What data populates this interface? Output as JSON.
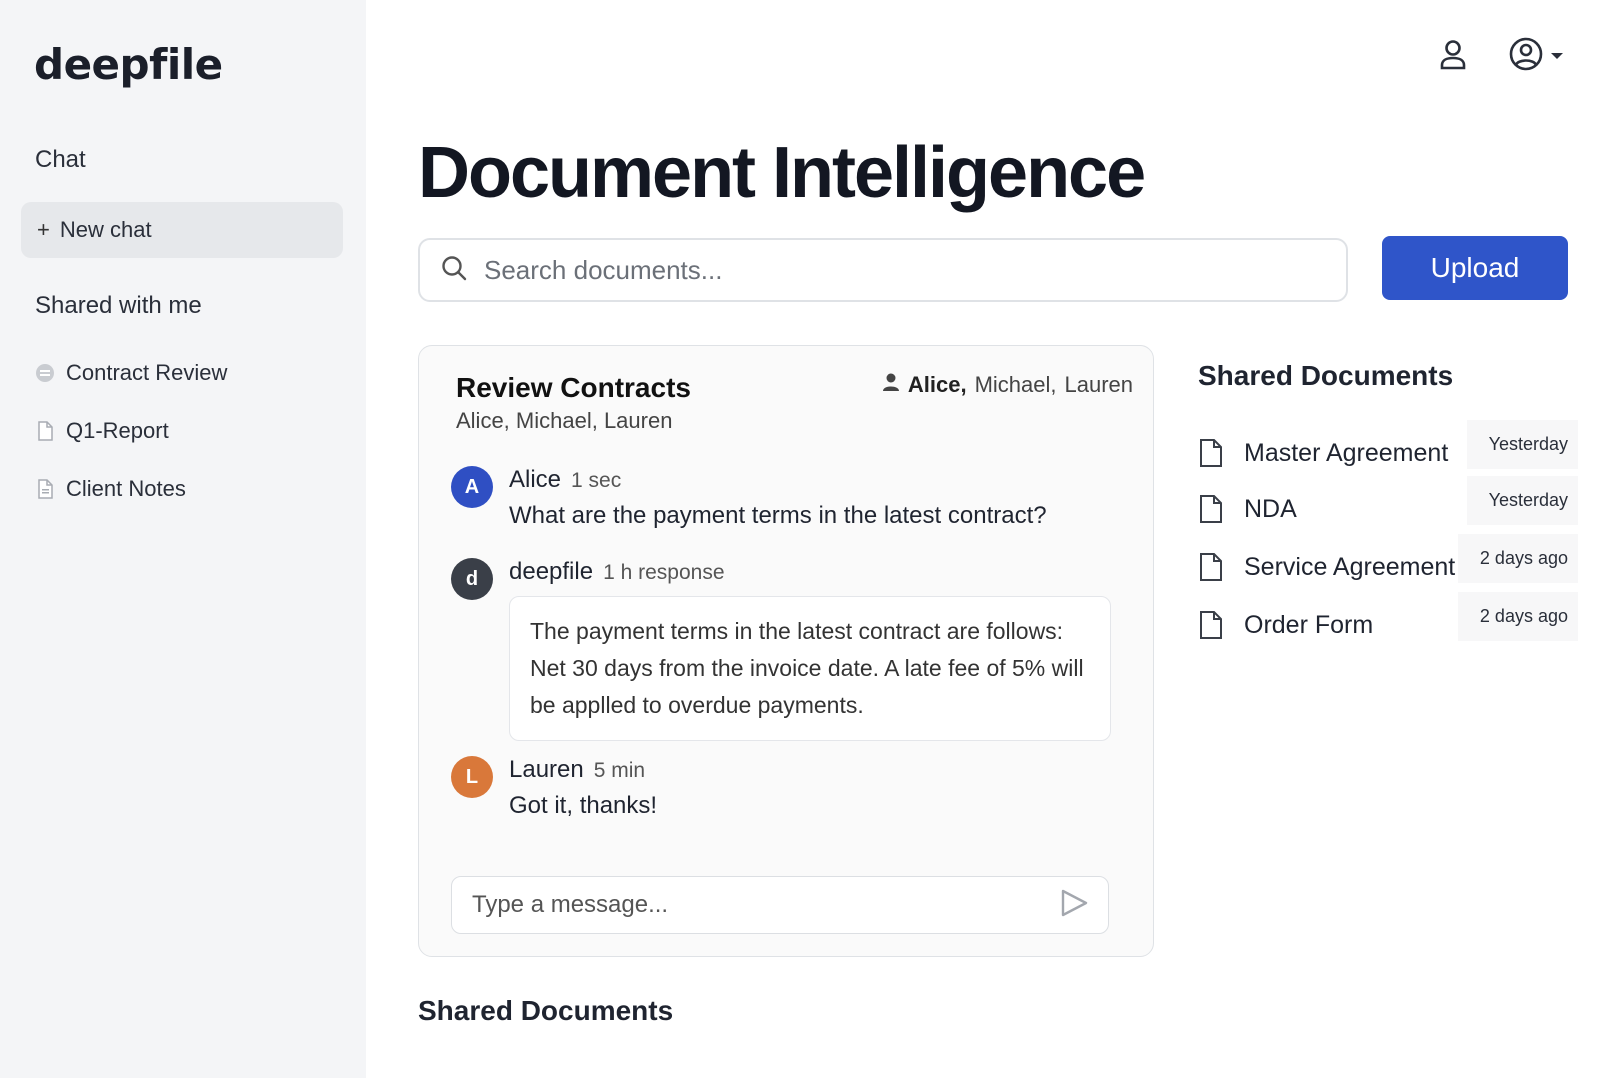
{
  "sidebar": {
    "logo": "deepfile",
    "chat_heading": "Chat",
    "new_chat_plus": "+",
    "new_chat_label": "New chat",
    "shared_heading": "Shared with me",
    "items": [
      {
        "label": "Contract Review",
        "icon": "chat-bubble-icon"
      },
      {
        "label": "Q1-Report",
        "icon": "file-icon"
      },
      {
        "label": "Client Notes",
        "icon": "note-file-icon"
      }
    ]
  },
  "header": {
    "icons": [
      "user-icon",
      "account-circle-icon",
      "caret-down-icon"
    ]
  },
  "main": {
    "title": "Document Intelligence",
    "search": {
      "placeholder": "Search documents..."
    },
    "upload_label": "Upload",
    "bottom_heading": "Shared Documents"
  },
  "chat": {
    "title": "Review Contracts",
    "subtitle": "Alice, Michael, Lauren",
    "participants": {
      "first": "Alice,",
      "second": "Michael,",
      "third": "Lauren"
    },
    "messages": [
      {
        "initial": "A",
        "author": "Alice",
        "time": "1 sec",
        "text": "What are the payment terms in the latest contract?",
        "color": "#2f4fc3"
      },
      {
        "initial": "d",
        "author": "deepfile",
        "time": "1 h response",
        "text": "The payment terms in the latest contract are follows: Net 30 days from the invoice date. A late fee of 5% will be applled to overdue payments.",
        "color": "#3a3f48"
      },
      {
        "initial": "L",
        "author": "Lauren",
        "time": "5 min",
        "text": "Got it, thanks!",
        "color": "#d9783a"
      }
    ],
    "composer_placeholder": "Type a message..."
  },
  "shared_docs": {
    "title": "Shared Documents",
    "items": [
      {
        "name": "Master Agreement",
        "date": "Yesterday"
      },
      {
        "name": "NDA",
        "date": "Yesterday"
      },
      {
        "name": "Service Agreement",
        "date": "2 days ago"
      },
      {
        "name": "Order Form",
        "date": "2 days ago"
      }
    ]
  },
  "colors": {
    "accent": "#2f55c9",
    "sidebar_bg": "#f4f5f7"
  }
}
